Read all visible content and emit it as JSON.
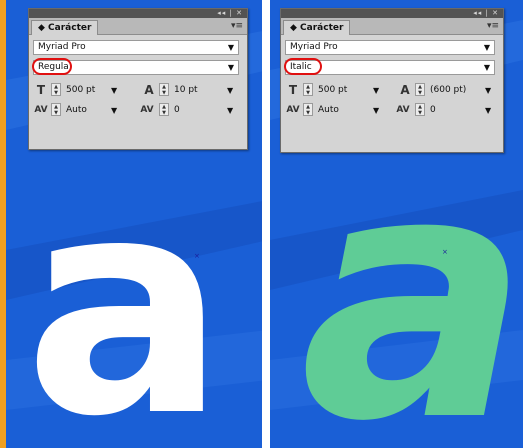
{
  "left": {
    "panel_title": "◆ Carácter",
    "titlebar_controls": "◂◂ | ✕",
    "menu_icon": "▾≡",
    "font_family": "Myriad Pro",
    "font_style": "Regula",
    "font_size": "500 pt",
    "leading": "10 pt",
    "kerning": "Auto",
    "tracking": "0",
    "letter": "a",
    "letter_color": "#ffffff"
  },
  "right": {
    "panel_title": "◆ Carácter",
    "titlebar_controls": "◂◂ | ✕",
    "menu_icon": "▾≡",
    "font_family": "Myriad Pro",
    "font_style": "Italic",
    "font_size": "500 pt",
    "leading": "(600 pt)",
    "kerning": "Auto",
    "tracking": "0",
    "letter": "a",
    "letter_color": "#5fcc96"
  },
  "colors": {
    "canvas_blue": "#1a5fd6",
    "border_orange": "#f0a020",
    "highlight_red": "#e01010"
  },
  "icons": {
    "font_size": "font-size-icon",
    "leading": "leading-icon",
    "kerning": "kerning-icon",
    "tracking": "tracking-icon",
    "spinner": "spinner-arrows-icon",
    "dropdown": "chevron-down-icon"
  }
}
